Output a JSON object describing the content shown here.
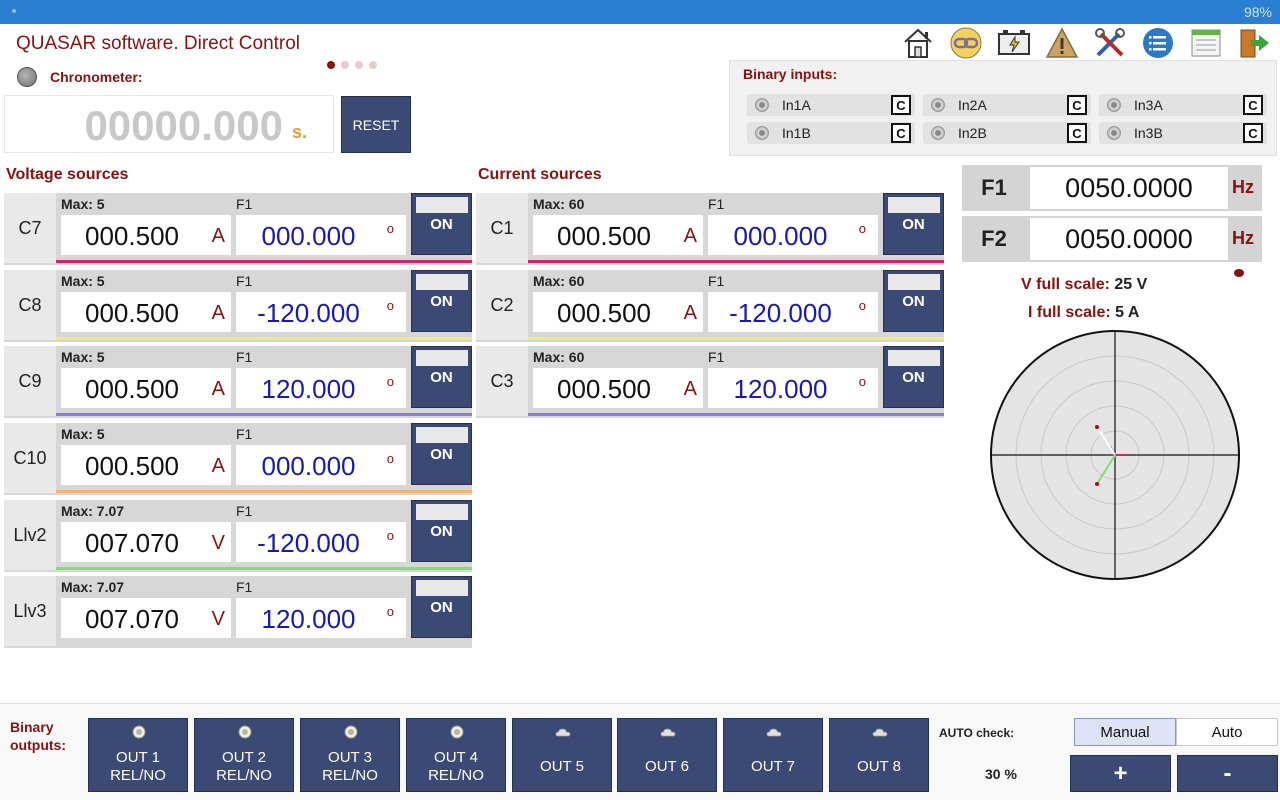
{
  "status": {
    "battery": "98%"
  },
  "app": {
    "title": "QUASAR software. Direct Control"
  },
  "chronometer": {
    "label": "Chronometer:",
    "value": "00000.000",
    "unit": "s.",
    "reset_label": "RESET"
  },
  "toolbar": {
    "icons": [
      "home-icon",
      "link-icon",
      "battery-charger-icon",
      "warning-icon",
      "tools-icon",
      "list-icon",
      "notes-icon",
      "exit-icon"
    ]
  },
  "binary_inputs": {
    "title": "Binary inputs:",
    "items": [
      {
        "label": "In1A",
        "c": "C"
      },
      {
        "label": "In2A",
        "c": "C"
      },
      {
        "label": "In3A",
        "c": "C"
      },
      {
        "label": "In1B",
        "c": "C"
      },
      {
        "label": "In2B",
        "c": "C"
      },
      {
        "label": "In3B",
        "c": "C"
      }
    ]
  },
  "voltage": {
    "title": "Voltage sources",
    "rows": [
      {
        "name": "C7",
        "max": "Max: 5",
        "f": "F1",
        "mag": "000.500",
        "unit": "A",
        "angle": "000.000",
        "deg": "o",
        "on": "ON",
        "color": "#d0246a"
      },
      {
        "name": "C8",
        "max": "Max: 5",
        "f": "F1",
        "mag": "000.500",
        "unit": "A",
        "angle": "-120.000",
        "deg": "o",
        "on": "ON",
        "color": "#f0ec74"
      },
      {
        "name": "C9",
        "max": "Max: 5",
        "f": "F1",
        "mag": "000.500",
        "unit": "A",
        "angle": "120.000",
        "deg": "o",
        "on": "ON",
        "color": "#8a7be0"
      },
      {
        "name": "C10",
        "max": "Max: 5",
        "f": "F1",
        "mag": "000.500",
        "unit": "A",
        "angle": "000.000",
        "deg": "o",
        "on": "ON",
        "color": "#f0b070"
      },
      {
        "name": "Llv2",
        "max": "Max: 7.07",
        "f": "F1",
        "mag": "007.070",
        "unit": "V",
        "angle": "-120.000",
        "deg": "o",
        "on": "ON",
        "color": "#7ee070"
      },
      {
        "name": "Llv3",
        "max": "Max: 7.07",
        "f": "F1",
        "mag": "007.070",
        "unit": "V",
        "angle": "120.000",
        "deg": "o",
        "on": "ON",
        "color": "#d8d8d8"
      }
    ]
  },
  "current": {
    "title": "Current sources",
    "rows": [
      {
        "name": "C1",
        "max": "Max: 60",
        "f": "F1",
        "mag": "000.500",
        "unit": "A",
        "angle": "000.000",
        "deg": "o",
        "on": "ON",
        "color": "#d0246a"
      },
      {
        "name": "C2",
        "max": "Max: 60",
        "f": "F1",
        "mag": "000.500",
        "unit": "A",
        "angle": "-120.000",
        "deg": "o",
        "on": "ON",
        "color": "#f0ec74"
      },
      {
        "name": "C3",
        "max": "Max: 60",
        "f": "F1",
        "mag": "000.500",
        "unit": "A",
        "angle": "120.000",
        "deg": "o",
        "on": "ON",
        "color": "#8a7be0"
      }
    ]
  },
  "frequency": {
    "f1": {
      "label": "F1",
      "value": "0050.0000",
      "unit": "Hz"
    },
    "f2": {
      "label": "F2",
      "value": "0050.0000",
      "unit": "Hz"
    }
  },
  "scale": {
    "v_label": "V full scale:",
    "v_value": "25 V",
    "i_label": "I full scale:",
    "i_value": "5 A"
  },
  "binary_outputs": {
    "title": "Binary outputs:",
    "items": [
      {
        "line1": "OUT 1",
        "line2": "REL/NO",
        "icon": "led-icon"
      },
      {
        "line1": "OUT 2",
        "line2": "REL/NO",
        "icon": "led-icon"
      },
      {
        "line1": "OUT 3",
        "line2": "REL/NO",
        "icon": "led-icon"
      },
      {
        "line1": "OUT 4",
        "line2": "REL/NO",
        "icon": "led-icon"
      },
      {
        "line1": "OUT 5",
        "line2": "",
        "icon": "cloud-icon"
      },
      {
        "line1": "OUT 6",
        "line2": "",
        "icon": "cloud-icon"
      },
      {
        "line1": "OUT 7",
        "line2": "",
        "icon": "cloud-icon"
      },
      {
        "line1": "OUT 8",
        "line2": "",
        "icon": "cloud-icon"
      }
    ]
  },
  "auto_check": {
    "label": "AUTO check:",
    "value": "30 %"
  },
  "mode": {
    "manual": "Manual",
    "auto": "Auto"
  },
  "stepper": {
    "plus": "+",
    "minus": "-"
  },
  "colors": {
    "accent": "#3b4a75",
    "title_red": "#8b1010",
    "angle_blue": "#1818b8"
  }
}
